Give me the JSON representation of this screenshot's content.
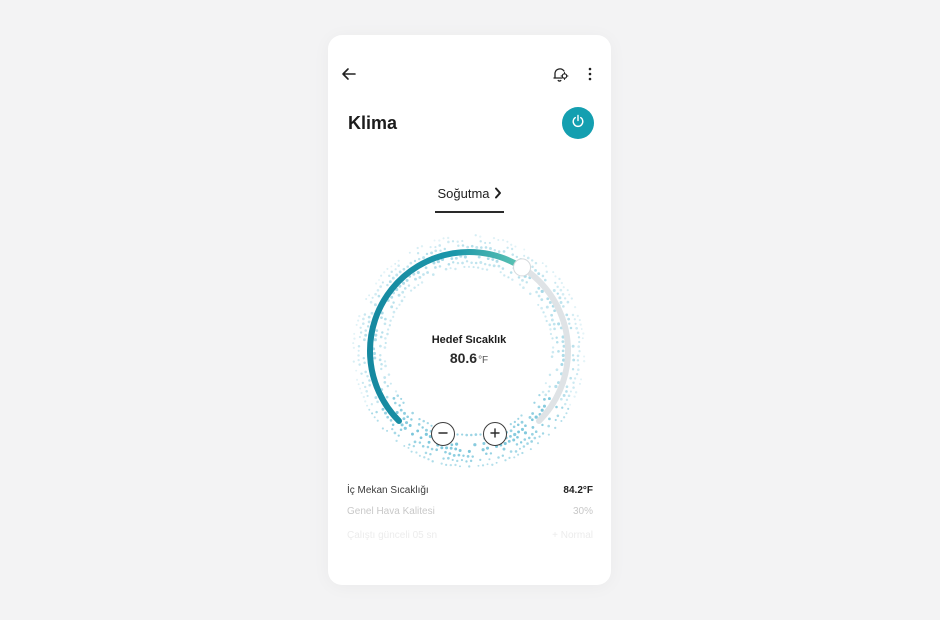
{
  "header": {
    "back_icon": "back-arrow-icon",
    "bell_icon": "bell-settings-icon",
    "more_icon": "more-vertical-icon"
  },
  "device": {
    "title": "Klima",
    "power_icon": "power-icon"
  },
  "mode": {
    "label": "Soğutma",
    "icon": "chevron-right-icon"
  },
  "thermostat": {
    "label": "Hedef Sıcaklık",
    "value": "80.6",
    "unit": "°F",
    "level": 0.62
  },
  "info": {
    "rows": [
      {
        "label": "İç Mekan Sıcaklığı",
        "value": "84.2°F"
      },
      {
        "label": "Genel Hava Kalitesi",
        "value": "30%"
      },
      {
        "label": "Çalıştı günceli 05 sn",
        "value": "+ Normal"
      }
    ]
  },
  "colors": {
    "accent": "#149fb0",
    "arc_start": "#1689a0",
    "arc_end": "#5ec5b3",
    "track": "#dfe3e6"
  }
}
